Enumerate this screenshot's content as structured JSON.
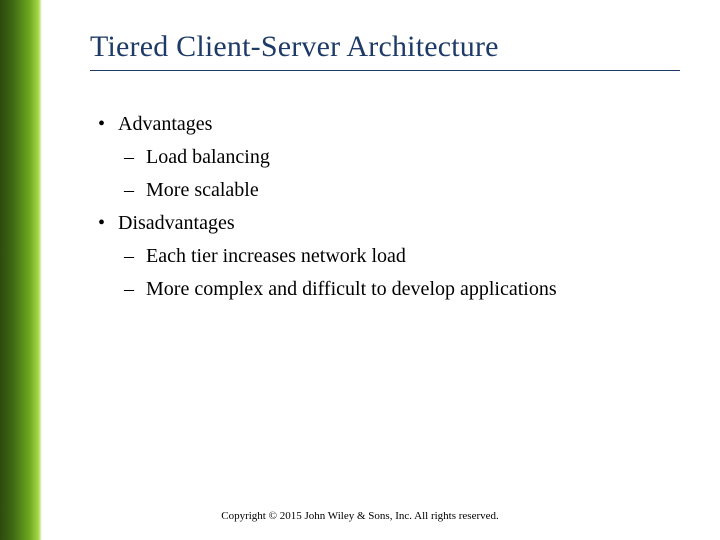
{
  "slide": {
    "title": "Tiered Client-Server Architecture",
    "bullets": [
      {
        "text": "Advantages",
        "sub": [
          "Load balancing",
          "More scalable"
        ]
      },
      {
        "text": "Disadvantages",
        "sub": [
          "Each tier increases network load",
          "More complex and difficult to develop applications"
        ]
      }
    ],
    "footer": "Copyright © 2015 John Wiley & Sons, Inc. All rights reserved."
  }
}
